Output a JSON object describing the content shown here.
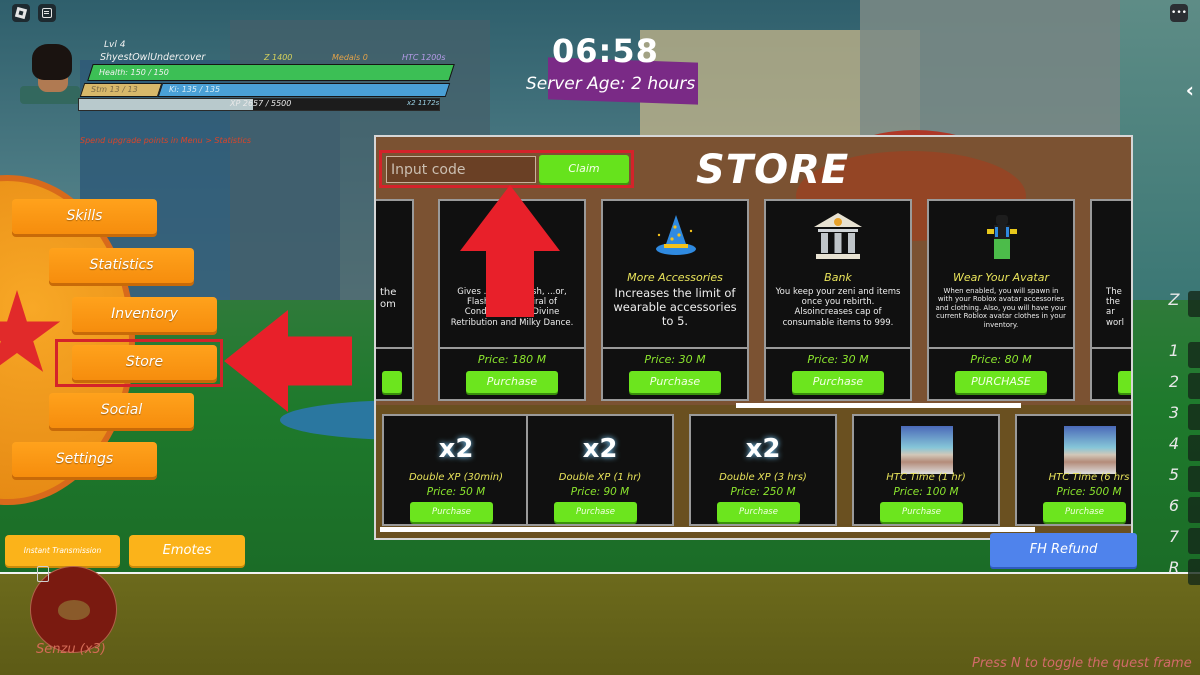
{
  "hud": {
    "level": "Lvl 4",
    "player_name": "ShyestOwlUndercover",
    "zeni": "Z 1400",
    "medals": "Medals 0",
    "htc": "HTC 1200s",
    "health": "Health: 150 / 150",
    "health_fraction": 1.0,
    "stamina": "Stm 13 / 13",
    "ki": "Ki: 135 / 135",
    "xp": "XP 2657 / 5500",
    "xp_fraction": 0.483,
    "xp_multiplier": "x2 1172s",
    "upgrade_hint": "Spend upgrade points in Menu > Statistics"
  },
  "timer": {
    "clock": "06:58",
    "server_age": "Server Age: 2 hours"
  },
  "menu": {
    "skills": "Skills",
    "statistics": "Statistics",
    "inventory": "Inventory",
    "store": "Store",
    "social": "Social",
    "settings": "Settings"
  },
  "quick_actions": {
    "instant_transmission": "Instant Transmission",
    "emotes": "Emotes"
  },
  "senzu": {
    "label": "Senzu (x3)"
  },
  "hotbar": {
    "keys": [
      "Z",
      "1",
      "2",
      "3",
      "4",
      "5",
      "6",
      "7",
      "R"
    ]
  },
  "store": {
    "title": "STORE",
    "code_placeholder": "Input code",
    "code_value": "",
    "claim_label": "Claim",
    "top_items": [
      {
        "title": "",
        "description": "...the ...om",
        "price": "",
        "button": ""
      },
      {
        "title": "...s",
        "description": "Gives ... Beast Rush, ...or, Flash Strike, Spiral of Condemnation, Divine Retribution and Milky Dance.",
        "price": "Price: 180 M",
        "button": "Purchase"
      },
      {
        "title": "More Accessories",
        "description": "Increases the limit of wearable accessories to 5.",
        "price": "Price: 30 M",
        "button": "Purchase",
        "icon": "wizard-hat-icon"
      },
      {
        "title": "Bank",
        "description": "You keep your zeni and items once you rebirth. Alsoincreases cap of consumable items to 999.",
        "price": "Price: 30 M",
        "button": "Purchase",
        "icon": "bank-icon"
      },
      {
        "title": "Wear Your Avatar",
        "description": "When enabled, you will spawn in with your Roblox avatar accessories and clothing. Also, you will have your current Roblox avatar clothes in your inventory.",
        "price": "Price: 80 M",
        "button": "PURCHASE",
        "icon": "avatar-icon"
      },
      {
        "title": "",
        "description": "The... the... ar... worl...",
        "price": "",
        "button": ""
      }
    ],
    "bottom_items": [
      {
        "badge": "x2",
        "title": "Double XP (30min)",
        "price": "Price: 50 M",
        "button": "Purchase"
      },
      {
        "badge": "x2",
        "title": "Double XP (1 hr)",
        "price": "Price: 90 M",
        "button": "Purchase"
      },
      {
        "badge": "x2",
        "title": "Double XP (3 hrs)",
        "price": "Price: 250 M",
        "button": "Purchase"
      },
      {
        "badge": "",
        "title": "HTC Time (1 hr)",
        "price": "Price: 100 M",
        "button": "Purchase",
        "icon": "htc-thumbnail"
      },
      {
        "badge": "",
        "title": "HTC Time (6 hrs",
        "price": "Price: 500 M",
        "button": "Purchase",
        "icon": "htc-thumbnail"
      }
    ]
  },
  "fh_refund_label": "FH Refund",
  "quest_hint": "Press N to toggle the quest frame",
  "colors": {
    "menu_orange": "#f68d0d",
    "purchase_green": "#6ce51e",
    "highlight_red": "#d4232a",
    "refund_blue": "#4f83ec"
  }
}
